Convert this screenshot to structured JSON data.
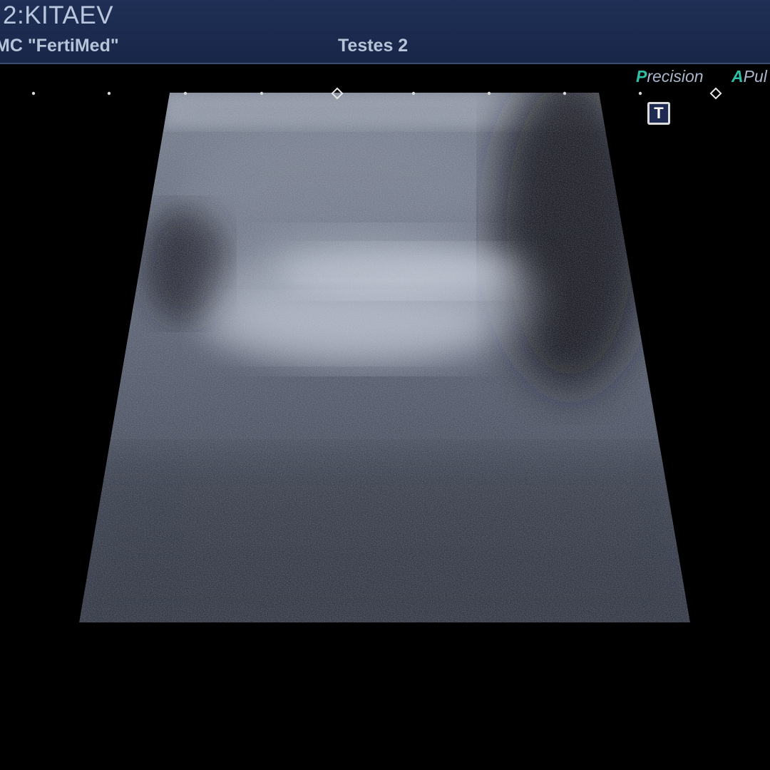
{
  "header": {
    "patient_name": "2:KITAEV",
    "clinic_name": "MC \"FertiMed\"",
    "exam_preset": "Testes 2"
  },
  "modes": {
    "precision_lead": "P",
    "precision_rest": "recision",
    "puls_lead": "A",
    "puls_rest": "Pul"
  },
  "image": {
    "type_indicator": "T",
    "depth_marker_count": 9,
    "focus_markers": 2
  },
  "colors": {
    "header_bg": "#1f2f55",
    "header_text": "#b7c3d8",
    "mode_accent": "#2fbfa6",
    "background": "#000000"
  },
  "icons": {
    "type_indicator": "text-box-icon",
    "focus_marker": "diamond-focus-icon"
  }
}
